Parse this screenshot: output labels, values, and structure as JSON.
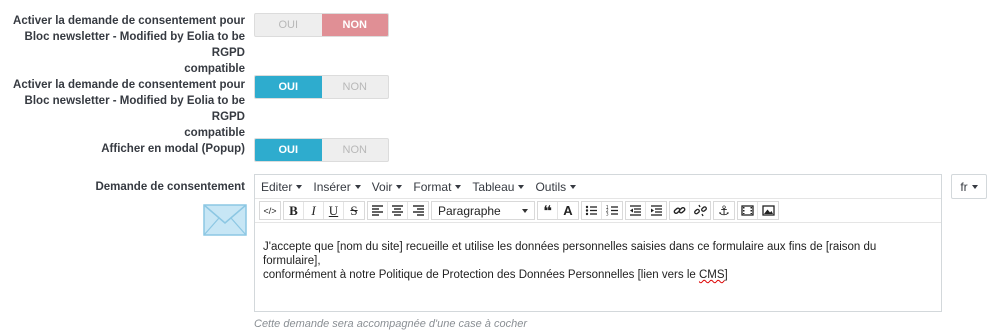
{
  "fields": [
    {
      "label_lines": [
        "Activer la demande de consentement pour",
        "Bloc newsletter - Modified by Eolia to be RGPD",
        "compatible"
      ],
      "yes_label": "OUI",
      "no_label": "NON",
      "selected": "no"
    },
    {
      "label_lines": [
        "Activer la demande de consentement pour",
        "Bloc newsletter - Modified by Eolia to be RGPD",
        "compatible"
      ],
      "yes_label": "OUI",
      "no_label": "NON",
      "selected": "yes"
    },
    {
      "label_lines": [
        "Afficher en modal (Popup)"
      ],
      "yes_label": "OUI",
      "no_label": "NON",
      "selected": "yes"
    }
  ],
  "consent": {
    "label": "Demande de consentement",
    "menu": [
      "Editer",
      "Insérer",
      "Voir",
      "Format",
      "Tableau",
      "Outils"
    ],
    "format_select": "Paragraphe",
    "content_line1": "J'accepte que [nom du site] recueille et utilise les données personnelles saisies dans ce formulaire aux fins de [raison du formulaire],",
    "content_line2_a": "conformément à notre Politique de Protection des Données Personnelles [lien vers le ",
    "content_line2_b": "CMS",
    "content_line2_c": "]",
    "language": "fr",
    "help_text": "Cette demande sera accompagnée d'une case à cocher"
  },
  "toolbar_icons": [
    "source-code-icon",
    "bold-icon",
    "italic-icon",
    "underline-icon",
    "strikethrough-icon",
    "align-left-icon",
    "align-center-icon",
    "align-right-icon",
    "blockquote-icon",
    "text-color-icon",
    "bullet-list-icon",
    "numbered-list-icon",
    "outdent-icon",
    "indent-icon",
    "link-icon",
    "unlink-icon",
    "anchor-icon",
    "media-icon",
    "image-icon"
  ],
  "colors": {
    "accent": "#2eacce",
    "no_active": "#e08f95",
    "envelope": "#9ed3ec"
  }
}
